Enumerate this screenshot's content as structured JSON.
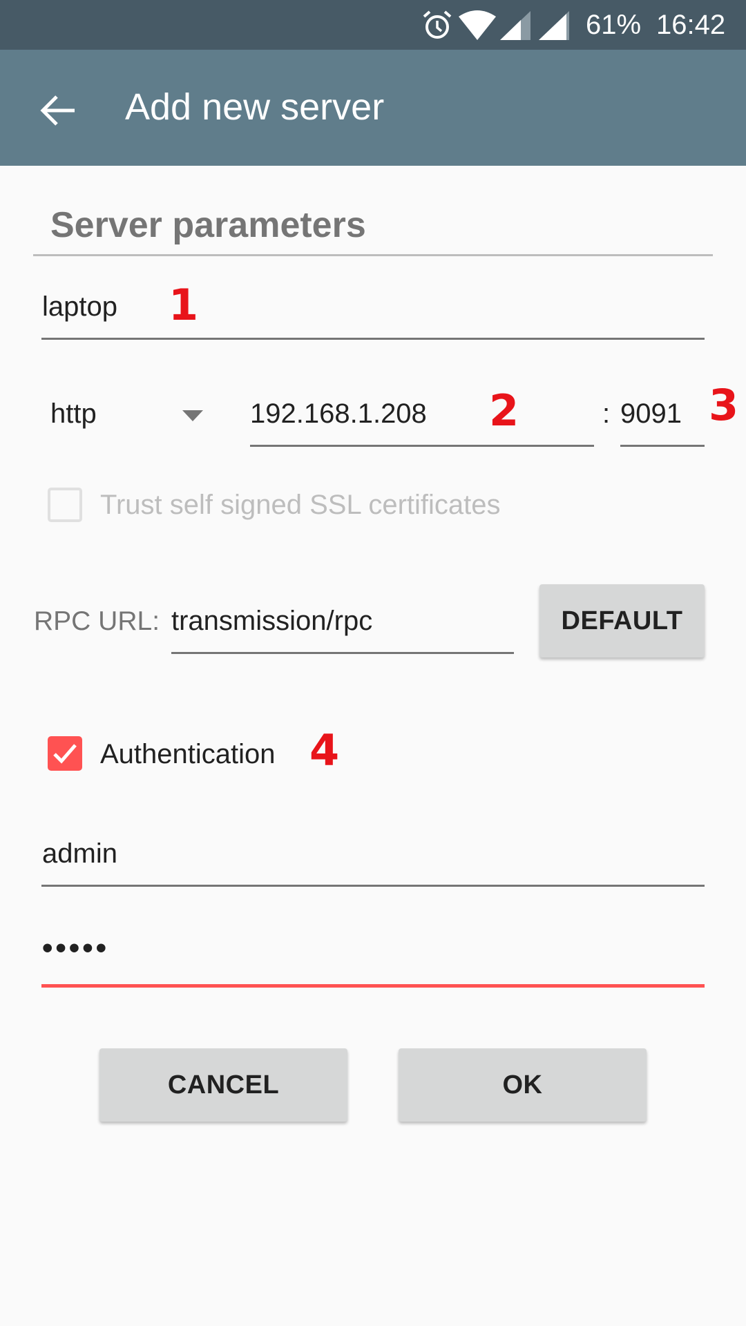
{
  "status_bar": {
    "battery": "61%",
    "time": "16:42",
    "icons": [
      "alarm-icon",
      "wifi-icon",
      "signal-icon",
      "signal-icon"
    ]
  },
  "app_bar": {
    "title": "Add new server",
    "back_icon": "arrow-back-icon"
  },
  "section_title": "Server parameters",
  "form": {
    "name_value": "laptop",
    "protocol_value": "http",
    "host_value": "192.168.1.208",
    "port_separator": ":",
    "port_value": "9091",
    "trust_ssl_label": "Trust self signed SSL certificates",
    "trust_ssl_checked": false,
    "rpc_label": "RPC URL:",
    "rpc_value": "transmission/rpc",
    "default_button": "DEFAULT",
    "auth_label": "Authentication",
    "auth_checked": true,
    "username_value": "admin",
    "password_value": "•••••"
  },
  "annotations": [
    "1",
    "2",
    "3",
    "4"
  ],
  "buttons": {
    "cancel": "CANCEL",
    "ok": "OK"
  },
  "colors": {
    "status_bar": "#475a66",
    "app_bar": "#607d8b",
    "accent": "#ff5252",
    "annotation": "#e8141a"
  }
}
